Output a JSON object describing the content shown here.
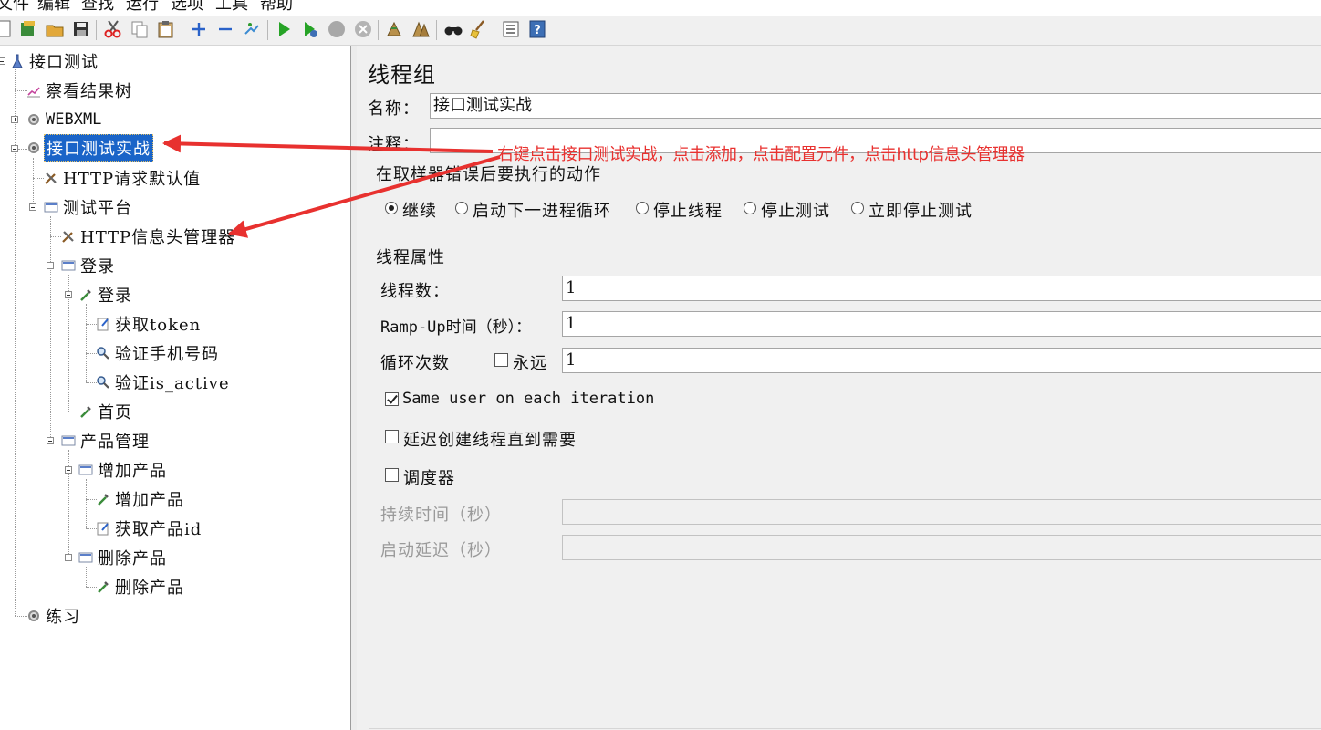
{
  "menu": [
    "文件",
    "编辑",
    "查找",
    "运行",
    "选项",
    "工具",
    "帮助"
  ],
  "toolbar": {
    "icons": [
      "new-icon",
      "templates-icon",
      "open-icon",
      "save-icon",
      "cut-icon",
      "copy-icon",
      "paste-icon",
      "expand-icon",
      "collapse-icon",
      "toggle-icon",
      "start-icon",
      "start-no-pause-icon",
      "stop-icon",
      "shutdown-icon",
      "clear-icon",
      "clear-all-icon",
      "search-icon",
      "reset-search-icon",
      "function-helper-icon",
      "help-icon"
    ]
  },
  "tree": {
    "root": "接口测试",
    "result_tree": "察看结果树",
    "webxml": "WEBXML",
    "selected": "接口测试实战",
    "http_defaults": "HTTP请求默认值",
    "platform": "测试平台",
    "header_manager": "HTTP信息头管理器",
    "login_ctrl": "登录",
    "login_sampler": "登录",
    "get_token": "获取token",
    "verify_phone": "验证手机号码",
    "verify_active": "验证is_active",
    "home": "首页",
    "product_mgmt": "产品管理",
    "add_product_ctrl": "增加产品",
    "add_product": "增加产品",
    "get_product_id": "获取产品id",
    "delete_product_ctrl": "删除产品",
    "delete_product": "删除产品",
    "practice": "练习"
  },
  "panel": {
    "title": "线程组",
    "name_label": "名称：",
    "name_value": "接口测试实战",
    "comment_label": "注释：",
    "comment_value": "",
    "error_group_title": "在取样器错误后要执行的动作",
    "error_actions": [
      "继续",
      "启动下一进程循环",
      "停止线程",
      "停止测试",
      "立即停止测试"
    ],
    "error_selected": "继续",
    "props_title": "线程属性",
    "threads_label": "线程数：",
    "threads_value": "1",
    "rampup_label": "Ramp-Up时间（秒）：",
    "rampup_value": "1",
    "loop_label": "循环次数",
    "forever_label": "永远",
    "forever_checked": false,
    "loop_value": "1",
    "same_user_label": "Same user on each iteration",
    "same_user_checked": true,
    "delay_label": "延迟创建线程直到需要",
    "delay_checked": false,
    "scheduler_label": "调度器",
    "scheduler_checked": false,
    "duration_label": "持续时间（秒）",
    "duration_value": "",
    "startup_delay_label": "启动延迟（秒）",
    "startup_delay_value": ""
  },
  "annotation": {
    "text": "右键点击接口测试实战，点击添加，点击配置元件，点击http信息头管理器",
    "color": "#e8312f"
  }
}
